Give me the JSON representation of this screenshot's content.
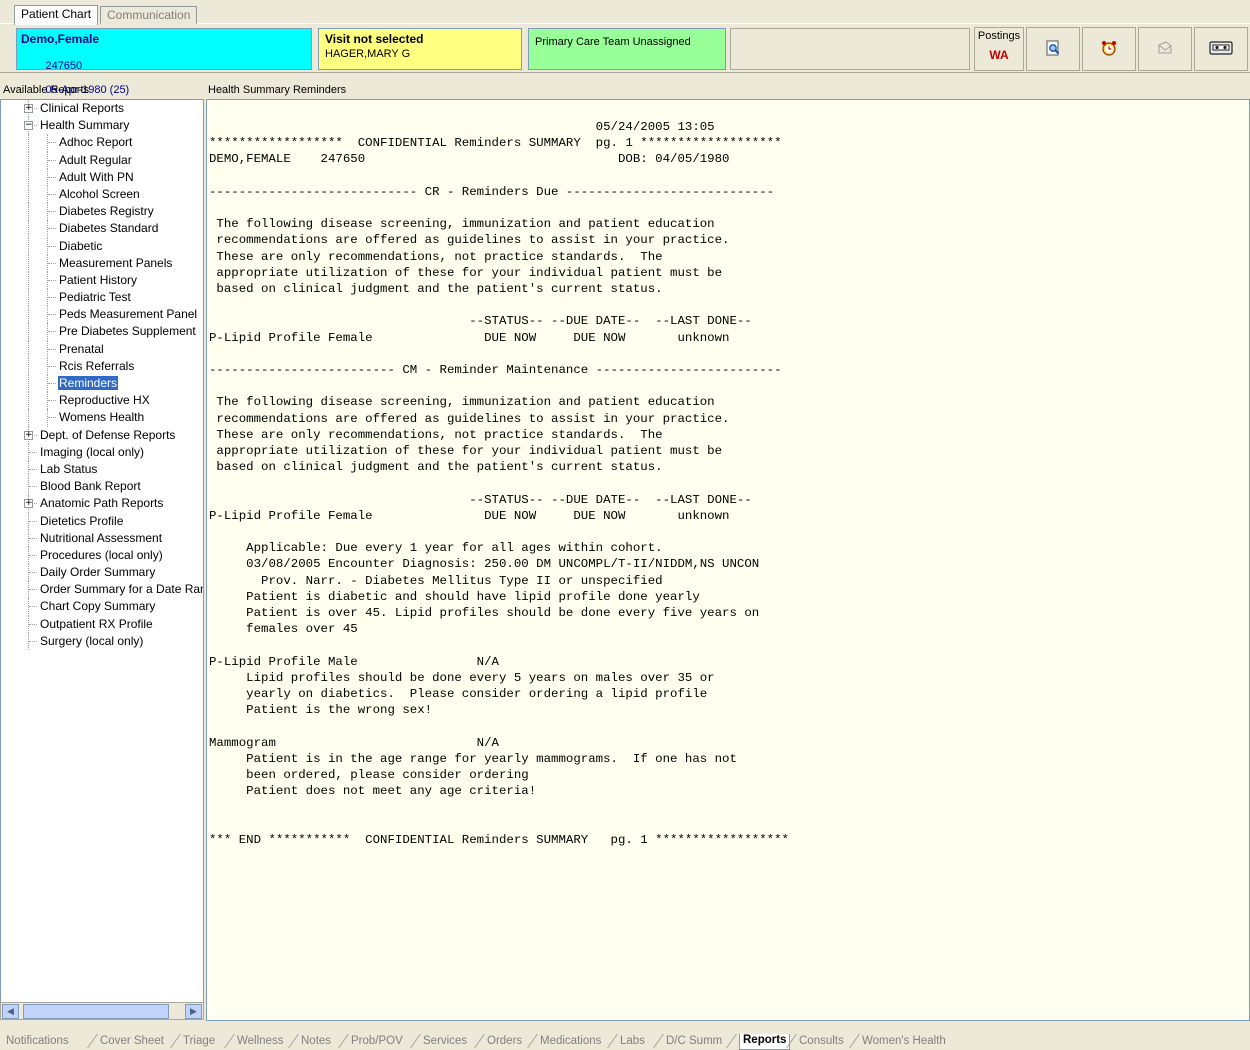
{
  "top_tabs": [
    {
      "label": "Patient Chart",
      "active": true
    },
    {
      "label": "Communication",
      "active": false
    }
  ],
  "patient": {
    "name": "Demo,Female",
    "id": "247650",
    "dob": "05-Apr-1980 (25)",
    "sex": "F"
  },
  "visit": {
    "title": "Visit not selected",
    "provider": "HAGER,MARY G"
  },
  "team": "Primary Care Team Unassigned",
  "postings": {
    "label": "Postings",
    "value": "WA"
  },
  "header_icons": [
    "report-preview-icon",
    "alarm-clock-icon",
    "mail-icon",
    "tape-cassette-icon"
  ],
  "left_panel": {
    "title": "Available Reports",
    "tree": [
      {
        "label": "Clinical Reports",
        "level": 0,
        "expander": "+"
      },
      {
        "label": "Health Summary",
        "level": 0,
        "expander": "−"
      },
      {
        "label": "Adhoc Report",
        "level": 1
      },
      {
        "label": "Adult Regular",
        "level": 1
      },
      {
        "label": "Adult With PN",
        "level": 1
      },
      {
        "label": "Alcohol Screen",
        "level": 1
      },
      {
        "label": "Diabetes Registry",
        "level": 1
      },
      {
        "label": "Diabetes Standard",
        "level": 1
      },
      {
        "label": "Diabetic",
        "level": 1
      },
      {
        "label": "Measurement Panels",
        "level": 1
      },
      {
        "label": "Patient History",
        "level": 1
      },
      {
        "label": "Pediatric Test",
        "level": 1
      },
      {
        "label": "Peds Measurement Panel",
        "level": 1
      },
      {
        "label": "Pre Diabetes Supplement",
        "level": 1
      },
      {
        "label": "Prenatal",
        "level": 1
      },
      {
        "label": "Rcis Referrals",
        "level": 1
      },
      {
        "label": "Reminders",
        "level": 1,
        "selected": true
      },
      {
        "label": "Reproductive HX",
        "level": 1
      },
      {
        "label": "Womens Health",
        "level": 1
      },
      {
        "label": "Dept. of Defense Reports",
        "level": 0,
        "expander": "+"
      },
      {
        "label": "Imaging (local only)",
        "level": 0
      },
      {
        "label": "Lab Status",
        "level": 0
      },
      {
        "label": "Blood Bank Report",
        "level": 0
      },
      {
        "label": "Anatomic Path Reports",
        "level": 0,
        "expander": "+"
      },
      {
        "label": "Dietetics Profile",
        "level": 0
      },
      {
        "label": "Nutritional Assessment",
        "level": 0
      },
      {
        "label": "Procedures (local only)",
        "level": 0
      },
      {
        "label": "Daily Order Summary",
        "level": 0
      },
      {
        "label": "Order Summary for a Date Rang",
        "level": 0
      },
      {
        "label": "Chart Copy Summary",
        "level": 0
      },
      {
        "label": "Outpatient RX Profile",
        "level": 0
      },
      {
        "label": "Surgery (local only)",
        "level": 0
      }
    ]
  },
  "report": {
    "title": "Health Summary Reminders",
    "lines": [
      "                                                    05/24/2005 13:05",
      "******************  CONFIDENTIAL Reminders SUMMARY  pg. 1 *******************",
      "DEMO,FEMALE    247650                                  DOB: 04/05/1980",
      "",
      "---------------------------- CR - Reminders Due ----------------------------",
      "",
      " The following disease screening, immunization and patient education",
      " recommendations are offered as guidelines to assist in your practice.",
      " These are only recommendations, not practice standards.  The",
      " appropriate utilization of these for your individual patient must be",
      " based on clinical judgment and the patient's current status.",
      "",
      "                                   --STATUS-- --DUE DATE--  --LAST DONE--",
      "P-Lipid Profile Female               DUE NOW     DUE NOW       unknown",
      "",
      "------------------------- CM - Reminder Maintenance -------------------------",
      "",
      " The following disease screening, immunization and patient education",
      " recommendations are offered as guidelines to assist in your practice.",
      " These are only recommendations, not practice standards.  The",
      " appropriate utilization of these for your individual patient must be",
      " based on clinical judgment and the patient's current status.",
      "",
      "                                   --STATUS-- --DUE DATE--  --LAST DONE--",
      "P-Lipid Profile Female               DUE NOW     DUE NOW       unknown",
      "",
      "     Applicable: Due every 1 year for all ages within cohort.",
      "     03/08/2005 Encounter Diagnosis: 250.00 DM UNCOMPL/T-II/NIDDM,NS UNCON",
      "       Prov. Narr. - Diabetes Mellitus Type II or unspecified",
      "     Patient is diabetic and should have lipid profile done yearly",
      "     Patient is over 45. Lipid profiles should be done every five years on",
      "     females over 45",
      "",
      "P-Lipid Profile Male                N/A",
      "     Lipid profiles should be done every 5 years on males over 35 or",
      "     yearly on diabetics.  Please consider ordering a lipid profile",
      "     Patient is the wrong sex!",
      "",
      "Mammogram                           N/A",
      "     Patient is in the age range for yearly mammograms.  If one has not",
      "     been ordered, please consider ordering",
      "     Patient does not meet any age criteria!",
      "",
      "",
      "*** END ***********  CONFIDENTIAL Reminders SUMMARY   pg. 1 ******************"
    ]
  },
  "bottom_tabs": [
    {
      "label": "Notifications"
    },
    {
      "label": "Cover Sheet"
    },
    {
      "label": "Triage"
    },
    {
      "label": "Wellness"
    },
    {
      "label": "Notes"
    },
    {
      "label": "Prob/POV"
    },
    {
      "label": "Services"
    },
    {
      "label": "Orders"
    },
    {
      "label": "Medications"
    },
    {
      "label": "Labs"
    },
    {
      "label": "D/C Summ"
    },
    {
      "label": "Reports",
      "active": true
    },
    {
      "label": "Consults"
    },
    {
      "label": "Women's Health"
    }
  ]
}
